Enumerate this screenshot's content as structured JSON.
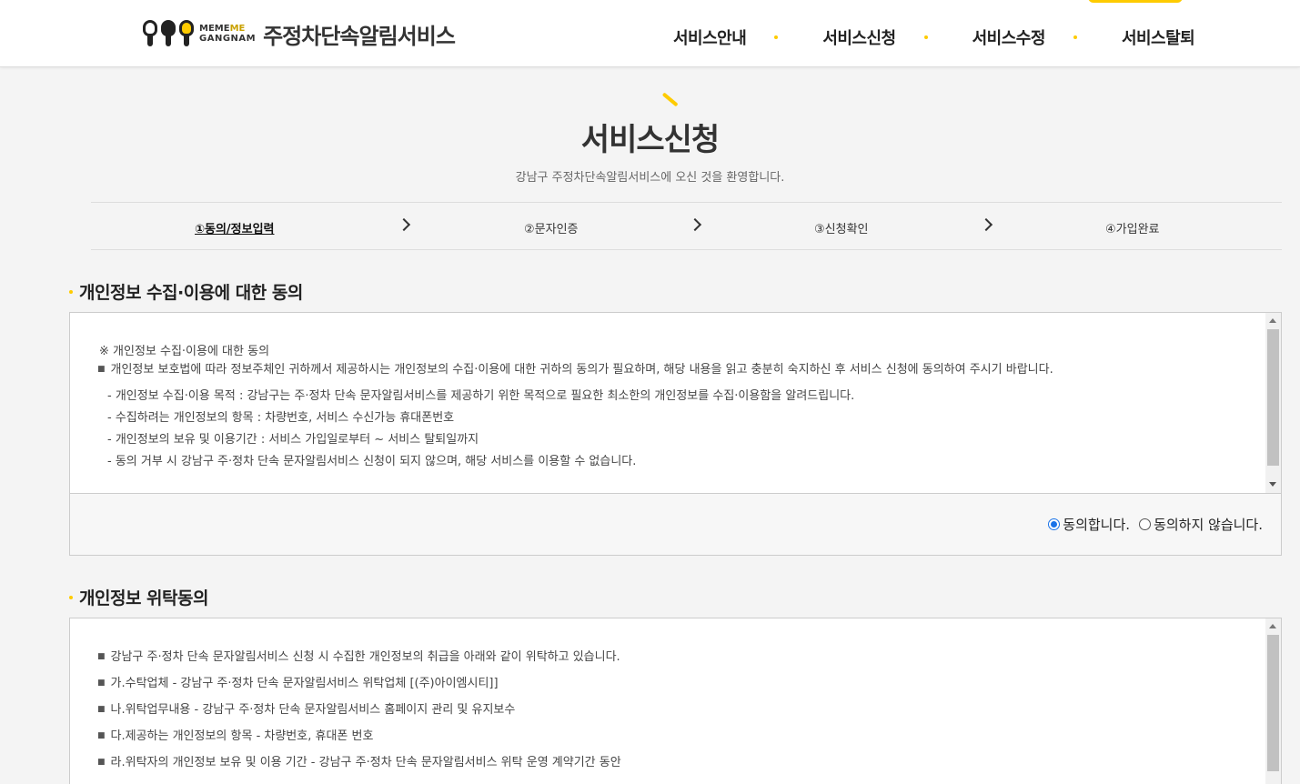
{
  "header": {
    "logo_word1": "MEME",
    "logo_word1_accent": "ME",
    "logo_word2": "GANGNAM",
    "logo_title": "주정차단속알림서비스",
    "nav": [
      "서비스안내",
      "서비스신청",
      "서비스수정",
      "서비스탈퇴"
    ]
  },
  "page": {
    "title": "서비스신청",
    "subtitle": "강남구 주정차단속알림서비스에 오신 것을 환영합니다."
  },
  "steps": [
    "①동의/정보입력",
    "②문자인증",
    "③신청확인",
    "④가입완료"
  ],
  "active_step": 0,
  "section1": {
    "title": "개인정보 수집·이용에 대한 동의",
    "heading": "※ 개인정보 수집·이용에 대한 동의",
    "intro": "개인정보 보호법에 따라 정보주체인 귀하께서 제공하시는 개인정보의 수집·이용에 대한 귀하의 동의가 필요하며, 해당 내용을 읽고 충분히 숙지하신 후 서비스 신청에 동의하여 주시기 바랍니다.",
    "items": [
      "- 개인정보 수집·이용 목적 : 강남구는 주·정차 단속 문자알림서비스를 제공하기 위한 목적으로 필요한 최소한의 개인정보를 수집·이용함을 알려드립니다.",
      "- 수집하려는 개인정보의 항목 : 차량번호, 서비스 수신가능 휴대폰번호",
      "- 개인정보의 보유 및 이용기간 : 서비스 가입일로부터 ~ 서비스 탈퇴일까지",
      "- 동의 거부 시 강남구 주·정차 단속 문자알림서비스 신청이 되지 않으며, 해당 서비스를 이용할 수 없습니다."
    ],
    "agree_label": "동의합니다.",
    "disagree_label": "동의하지 않습니다.",
    "selected": "agree"
  },
  "section2": {
    "title": "개인정보 위탁동의",
    "items": [
      "강남구 주·정차 단속 문자알림서비스 신청 시 수집한 개인정보의 취급을 아래와 같이 위탁하고 있습니다.",
      "가.수탁업체 - 강남구 주·정차 단속 문자알림서비스 위탁업체 [(주)아이엠시티]]",
      "나.위탁업무내용 - 강남구 주·정차 단속 문자알림서비스 홈페이지 관리 및 유지보수",
      "다.제공하는 개인정보의 항목 - 차량번호, 휴대폰 번호",
      "라.위탁자의 개인정보 보유 및 이용 기간 - 강남구 주·정차 단속 문자알림서비스 위탁 운영 계약기간 동안"
    ]
  },
  "colors": {
    "accent": "#fecb00",
    "radio": "#1a73e8"
  }
}
